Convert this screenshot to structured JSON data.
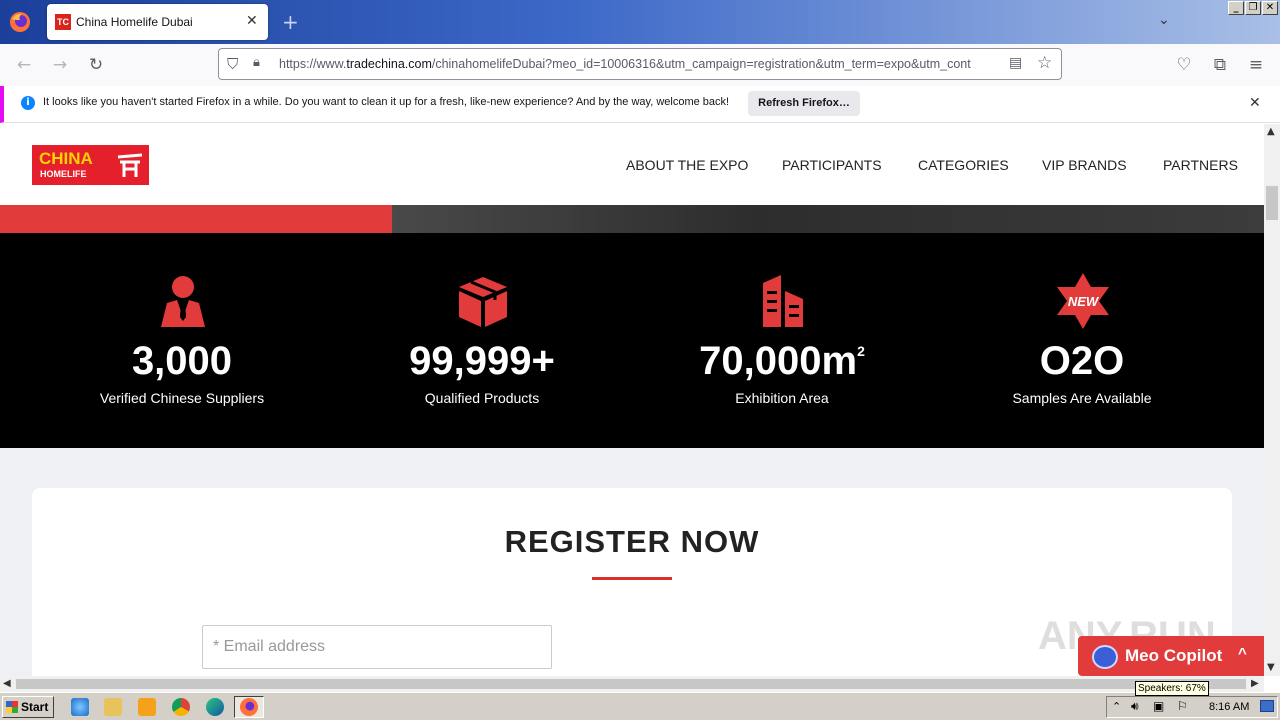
{
  "browser": {
    "tab": {
      "favicon_text": "TC",
      "title": "China Homelife Dubai",
      "close": "✕"
    },
    "new_tab": "+",
    "window_buttons": [
      "_",
      "❐",
      "✕"
    ],
    "url": {
      "prefix": "https://www.",
      "host": "tradechina.com",
      "path": "/chinahomelifeDubai?meo_id=10006316&utm_campaign=registration&utm_term=expo&utm_cont"
    },
    "notification": {
      "text": "It looks like you haven't started Firefox in a while. Do you want to clean it up for a fresh, like-new experience? And by the way, welcome back!",
      "button": "Refresh Firefox…",
      "close": "✕"
    }
  },
  "site": {
    "logo": {
      "top": "CHINA",
      "bottom": "HOMELIFE"
    },
    "nav": [
      "ABOUT THE EXPO",
      "PARTICIPANTS",
      "CATEGORIES",
      "VIP BRANDS",
      "PARTNERS"
    ],
    "stats": [
      {
        "icon": "person-icon",
        "value": "3,000",
        "sup": "",
        "label": "Verified Chinese Suppliers"
      },
      {
        "icon": "box-icon",
        "value": "99,999+",
        "sup": "",
        "label": "Qualified Products"
      },
      {
        "icon": "building-icon",
        "value": "70,000m",
        "sup": "2",
        "label": "Exhibition Area"
      },
      {
        "icon": "new-badge-icon",
        "value": "O2O",
        "sup": "",
        "label": "Samples Are Available"
      }
    ],
    "register": {
      "title": "REGISTER NOW",
      "email_placeholder": "* Email address"
    },
    "copilot": {
      "label": "Meo Copilot",
      "chevron": "^"
    },
    "watermark": "ANY.RUN",
    "new_badge": "NEW"
  },
  "taskbar": {
    "start": "Start",
    "clock": "8:16 AM",
    "tooltip": "Speakers: 67%"
  },
  "colors": {
    "accent_red": "#e23b3b",
    "logo_yellow": "#ffd200",
    "stats_bg": "#000000"
  }
}
